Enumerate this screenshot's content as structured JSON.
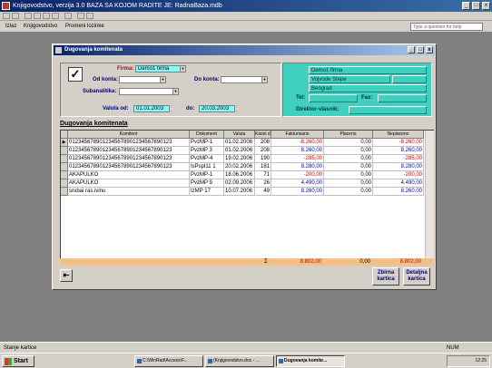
{
  "app": {
    "title": "Knjigovodstvo, verzija 3.0 BAZA SA KOJOM RADITE JE: RadnaBaza.mdb"
  },
  "menu": {
    "items": [
      "Izlaz",
      "Knjigovodstvo",
      "Promeni lozinke"
    ],
    "help_placeholder": "Type a question for help"
  },
  "form": {
    "title": "Dugovanja komitenata",
    "firma_label": "Firma:",
    "firma_value": "Demo1 firma",
    "od_konta_label": "Od konta:",
    "do_konta_label": "Do konta:",
    "subanalitika_label": "Subanalitika:",
    "valuta_od_label": "Valuta od:",
    "valuta_od_value": "01.01.2003",
    "valuta_do_label": "do:",
    "valuta_do_value": "20.03.2003",
    "info": {
      "name": "Demo1 firma",
      "street": "Vojvode Stepe",
      "city": "Beograd",
      "tel_label": "Tel:",
      "fax_label": "Fax:",
      "director_label": "Direktor-vlasnik:"
    },
    "section_title": "Dugovanja komitenata",
    "columns": [
      "Komitent",
      "Dokument",
      "Valuta",
      "Kasni d.",
      "Fakturisano",
      "Placeno",
      "Neplaceno"
    ],
    "rows": [
      [
        "0123456789012345678901234567890123",
        "PvzMP-1",
        "01.02.2006",
        "208",
        "-8.260,00",
        "0,00",
        "-8.260,00"
      ],
      [
        "0123456789012345678901234567890123",
        "PvzMP 3",
        "01.02.2006",
        "208",
        "8.260,00",
        "0,00",
        "8.260,00"
      ],
      [
        "0123456789012345678901234567890123",
        "PvzMP-4",
        "19.02.2006",
        "190",
        "-285,00",
        "0,00",
        "-285,00"
      ],
      [
        "0123456789012345678901234567890123",
        "IsPspl11 1",
        "20.02.2006",
        "181",
        "8.280,00",
        "0,00",
        "8.280,00"
      ],
      [
        "AKAPULKO",
        "PvzMP-1",
        "18.06.2006",
        "71",
        "-200,00",
        "0,00",
        "-200,00"
      ],
      [
        "AKAPULKO",
        "PvzMP 9",
        "02.09.2006",
        "26",
        "4.490,00",
        "0,00",
        "4.490,00"
      ],
      [
        "srubai ras.ivinu",
        "IzMP 17",
        "10.07.2006",
        "49",
        "8.260,00",
        "0,00",
        "8.260,00"
      ]
    ],
    "totals": {
      "sigma": "Σ",
      "fakturisano": "8.802,00",
      "placeno": "0,00",
      "neplaceno": "8.802,00"
    },
    "buttons": {
      "zbirna": "Zbirna kartica",
      "detaljna": "Detaljna kartica"
    }
  },
  "statusbar": {
    "text": "Stanje kartice",
    "mode": "NUM"
  },
  "taskbar": {
    "start": "Start",
    "tasks": [
      "C:\\WinRad\\Access\\F...",
      "(Knjigovodstvo.doc - ...",
      "Dugovanja komite..."
    ],
    "time": "12:25"
  },
  "colors": {
    "negative": "#cc0000",
    "positive": "#0000aa",
    "info_panel": "#40d0c0",
    "totals_bar": "#f5c088"
  }
}
